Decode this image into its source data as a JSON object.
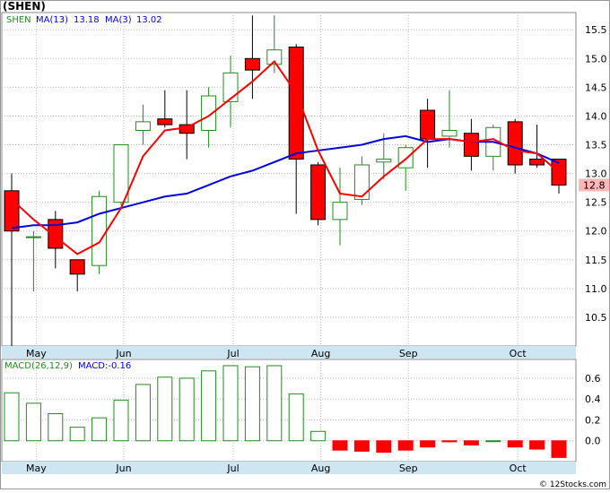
{
  "header": {
    "symbol_title": "(SHEN)",
    "ticker": "SHEN",
    "ma13_label": "MA(13)",
    "ma13_value": "13.18",
    "ma3_label": "MA(3)",
    "ma3_value": "13.02",
    "last_price_tag": "12.8"
  },
  "macd_header": {
    "label": "MACD(26,12,9)",
    "value_label": "MACD:-0.16"
  },
  "footer": {
    "copyright": "© 12Stocks.com"
  },
  "colors": {
    "up_candle_stroke": "#228b22",
    "down_candle_fill": "#ff0000",
    "ma13": "#0000dd",
    "ma3": "#ff0000",
    "macd_up_stroke": "#228b22",
    "macd_down_fill": "#ff0000",
    "axis_band": "#cde6f2",
    "grid": "#bbbbbb",
    "price_tag_bg": "#ffb6b6"
  },
  "chart_data": [
    {
      "type": "candlestick",
      "interval": "weekly",
      "title": "(SHEN)",
      "ylim": [
        10,
        15.8
      ],
      "y_ticks": [
        10.5,
        11.0,
        11.5,
        12.0,
        12.5,
        13.0,
        13.5,
        14.0,
        14.5,
        15.0,
        15.5
      ],
      "x_tick_labels": [
        "May",
        "Jun",
        "Jul",
        "Aug",
        "Sep",
        "Oct"
      ],
      "x_tick_week_index": [
        1,
        5,
        10,
        14,
        18,
        23
      ],
      "grid": true,
      "last_price": 12.8,
      "candles": [
        {
          "open": 12.7,
          "high": 13.0,
          "low": 10.0,
          "close": 12.0
        },
        {
          "open": 11.9,
          "high": 12.0,
          "low": 10.95,
          "close": 11.9
        },
        {
          "open": 12.2,
          "high": 12.35,
          "low": 11.35,
          "close": 11.7
        },
        {
          "open": 11.5,
          "high": 11.5,
          "low": 10.95,
          "close": 11.25
        },
        {
          "open": 11.4,
          "high": 12.7,
          "low": 11.25,
          "close": 12.6
        },
        {
          "open": 12.5,
          "high": 13.5,
          "low": 12.45,
          "close": 13.5
        },
        {
          "open": 13.75,
          "high": 14.2,
          "low": 13.5,
          "close": 13.9
        },
        {
          "open": 13.95,
          "high": 14.45,
          "low": 13.8,
          "close": 13.85
        },
        {
          "open": 13.85,
          "high": 14.45,
          "low": 13.25,
          "close": 13.7
        },
        {
          "open": 13.75,
          "high": 14.5,
          "low": 13.45,
          "close": 14.35
        },
        {
          "open": 14.25,
          "high": 15.05,
          "low": 13.8,
          "close": 14.75
        },
        {
          "open": 15.0,
          "high": 15.75,
          "low": 14.3,
          "close": 14.8
        },
        {
          "open": 14.9,
          "high": 15.75,
          "low": 14.75,
          "close": 15.15
        },
        {
          "open": 15.2,
          "high": 15.25,
          "low": 12.3,
          "close": 13.25
        },
        {
          "open": 13.15,
          "high": 13.2,
          "low": 12.1,
          "close": 12.2
        },
        {
          "open": 12.2,
          "high": 13.1,
          "low": 11.75,
          "close": 12.5
        },
        {
          "open": 12.55,
          "high": 13.3,
          "low": 12.45,
          "close": 13.15
        },
        {
          "open": 13.2,
          "high": 13.7,
          "low": 12.9,
          "close": 13.25
        },
        {
          "open": 13.1,
          "high": 13.5,
          "low": 12.7,
          "close": 13.45
        },
        {
          "open": 14.1,
          "high": 14.3,
          "low": 13.1,
          "close": 13.6
        },
        {
          "open": 13.65,
          "high": 14.45,
          "low": 13.45,
          "close": 13.75
        },
        {
          "open": 13.7,
          "high": 13.95,
          "low": 13.05,
          "close": 13.3
        },
        {
          "open": 13.3,
          "high": 13.85,
          "low": 13.05,
          "close": 13.8
        },
        {
          "open": 13.9,
          "high": 13.95,
          "low": 13.0,
          "close": 13.15
        },
        {
          "open": 13.25,
          "high": 13.85,
          "low": 13.1,
          "close": 13.15
        },
        {
          "open": 13.25,
          "high": 13.25,
          "low": 12.65,
          "close": 12.8
        }
      ],
      "series": [
        {
          "name": "MA(3)",
          "values": [
            12.55,
            12.2,
            11.9,
            11.6,
            11.8,
            12.4,
            13.3,
            13.75,
            13.8,
            14.0,
            14.3,
            14.6,
            14.95,
            14.4,
            13.4,
            12.65,
            12.6,
            12.95,
            13.25,
            13.6,
            13.6,
            13.55,
            13.6,
            13.4,
            13.35,
            13.02
          ]
        },
        {
          "name": "MA(13)",
          "values": [
            12.05,
            12.1,
            12.1,
            12.15,
            12.3,
            12.4,
            12.5,
            12.6,
            12.65,
            12.8,
            12.95,
            13.05,
            13.2,
            13.35,
            13.4,
            13.45,
            13.5,
            13.6,
            13.65,
            13.55,
            13.6,
            13.55,
            13.55,
            13.45,
            13.35,
            13.18
          ]
        }
      ]
    },
    {
      "type": "bar",
      "title": "MACD(26,12,9)",
      "ylim": [
        -0.2,
        0.78
      ],
      "y_ticks": [
        0.0,
        0.2,
        0.4,
        0.6
      ],
      "x_tick_labels": [
        "May",
        "Jun",
        "Jul",
        "Aug",
        "Sep",
        "Oct"
      ],
      "grid": true,
      "series": [
        {
          "name": "MACD",
          "values": [
            0.46,
            0.36,
            0.26,
            0.13,
            0.22,
            0.39,
            0.54,
            0.61,
            0.6,
            0.67,
            0.72,
            0.71,
            0.72,
            0.45,
            0.09,
            -0.09,
            -0.1,
            -0.11,
            -0.09,
            -0.06,
            -0.01,
            -0.04,
            0.0,
            -0.06,
            -0.08,
            -0.16
          ]
        }
      ]
    }
  ]
}
